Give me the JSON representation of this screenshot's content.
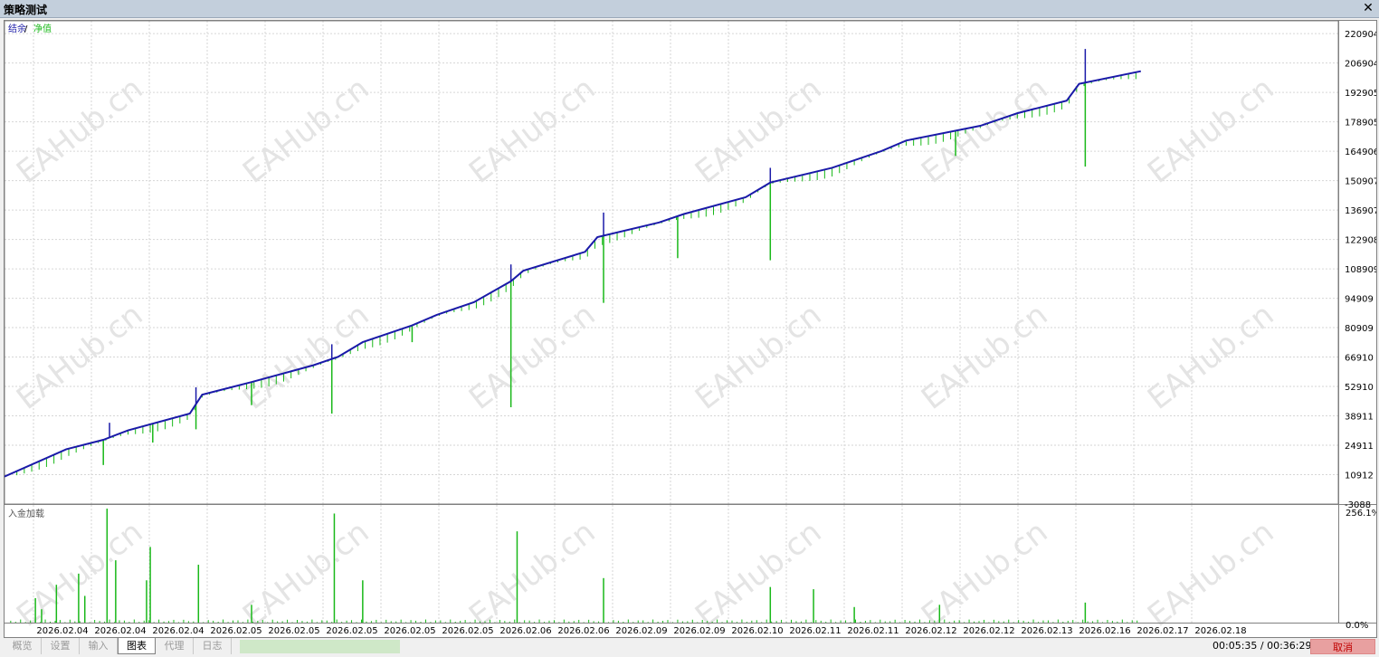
{
  "window": {
    "title": "策略测试",
    "close_glyph": "✕"
  },
  "legend": {
    "balance_label": "结余",
    "sep": " / ",
    "equity_label": "净值",
    "balance_color": "#1a1aa8",
    "equity_color": "#19b819"
  },
  "bottom_panel": {
    "label": "入金加载",
    "ymax_label": "256.1%",
    "ymin_label": "0.0%"
  },
  "watermark": "EAHub.cn",
  "tabs": [
    {
      "label": "概览"
    },
    {
      "label": "设置"
    },
    {
      "label": "输入"
    },
    {
      "label": "图表"
    },
    {
      "label": "代理"
    },
    {
      "label": "日志"
    }
  ],
  "active_tab": "图表",
  "status": {
    "timer": "00:05:35 / 00:36:29",
    "cancel_label": "取消",
    "progress": 0.16
  },
  "chart_data": [
    {
      "type": "line",
      "title": "",
      "series": [
        {
          "name": "结余",
          "color": "#1a1aa8"
        },
        {
          "name": "净值",
          "color": "#19b819"
        }
      ],
      "x": [
        "2026.02.04",
        "2026.02.04",
        "2026.02.04",
        "2026.02.05",
        "2026.02.05",
        "2026.02.05",
        "2026.02.05",
        "2026.02.05",
        "2026.02.06",
        "2026.02.06",
        "2026.02.09",
        "2026.02.09",
        "2026.02.10",
        "2026.02.11",
        "2026.02.11",
        "2026.02.12",
        "2026.02.12",
        "2026.02.13",
        "2026.02.16",
        "2026.02.17",
        "2026.02.18"
      ],
      "y_ticks": [
        220904,
        206904,
        192905,
        178905,
        164906,
        150907,
        136907,
        122908,
        108909,
        94909,
        80909,
        66910,
        52910,
        38911,
        24911,
        10912,
        -3088
      ],
      "ylim": [
        -3088,
        227000
      ],
      "balance_points": [
        [
          0.0,
          10000
        ],
        [
          0.05,
          23000
        ],
        [
          0.08,
          27500
        ],
        [
          0.1,
          32000
        ],
        [
          0.15,
          40000
        ],
        [
          0.16,
          49000
        ],
        [
          0.2,
          55000
        ],
        [
          0.25,
          63000
        ],
        [
          0.27,
          67000
        ],
        [
          0.29,
          74000
        ],
        [
          0.33,
          82000
        ],
        [
          0.35,
          87000
        ],
        [
          0.38,
          93000
        ],
        [
          0.41,
          103000
        ],
        [
          0.42,
          108000
        ],
        [
          0.47,
          117000
        ],
        [
          0.48,
          124000
        ],
        [
          0.53,
          131000
        ],
        [
          0.55,
          135000
        ],
        [
          0.6,
          143000
        ],
        [
          0.62,
          150000
        ],
        [
          0.67,
          157000
        ],
        [
          0.71,
          165000
        ],
        [
          0.73,
          170000
        ],
        [
          0.79,
          177000
        ],
        [
          0.82,
          183000
        ],
        [
          0.86,
          189000
        ],
        [
          0.87,
          197000
        ],
        [
          0.92,
          203000
        ]
      ],
      "equity_spikes": [
        [
          0.08,
          -12000
        ],
        [
          0.12,
          -9000
        ],
        [
          0.155,
          -12000
        ],
        [
          0.2,
          -11000
        ],
        [
          0.265,
          -26000
        ],
        [
          0.33,
          -8000
        ],
        [
          0.41,
          -60000
        ],
        [
          0.485,
          -32000
        ],
        [
          0.545,
          -20000
        ],
        [
          0.62,
          -37000
        ],
        [
          0.77,
          -12000
        ],
        [
          0.875,
          -40000
        ]
      ],
      "balance_spikes": [
        [
          0.085,
          7000
        ],
        [
          0.155,
          8000
        ],
        [
          0.265,
          7000
        ],
        [
          0.41,
          8000
        ],
        [
          0.485,
          11000
        ],
        [
          0.62,
          7000
        ],
        [
          0.875,
          16000
        ]
      ]
    },
    {
      "type": "bar",
      "title": "",
      "ylim": [
        0,
        256.1
      ],
      "y_unit": "%",
      "bars": [
        [
          0.025,
          55
        ],
        [
          0.03,
          30
        ],
        [
          0.042,
          85
        ],
        [
          0.06,
          110
        ],
        [
          0.065,
          60
        ],
        [
          0.083,
          256
        ],
        [
          0.09,
          140
        ],
        [
          0.115,
          95
        ],
        [
          0.118,
          170
        ],
        [
          0.157,
          130
        ],
        [
          0.2,
          40
        ],
        [
          0.267,
          245
        ],
        [
          0.29,
          95
        ],
        [
          0.415,
          205
        ],
        [
          0.485,
          100
        ],
        [
          0.62,
          80
        ],
        [
          0.655,
          75
        ],
        [
          0.688,
          35
        ],
        [
          0.757,
          40
        ],
        [
          0.875,
          45
        ]
      ]
    }
  ]
}
